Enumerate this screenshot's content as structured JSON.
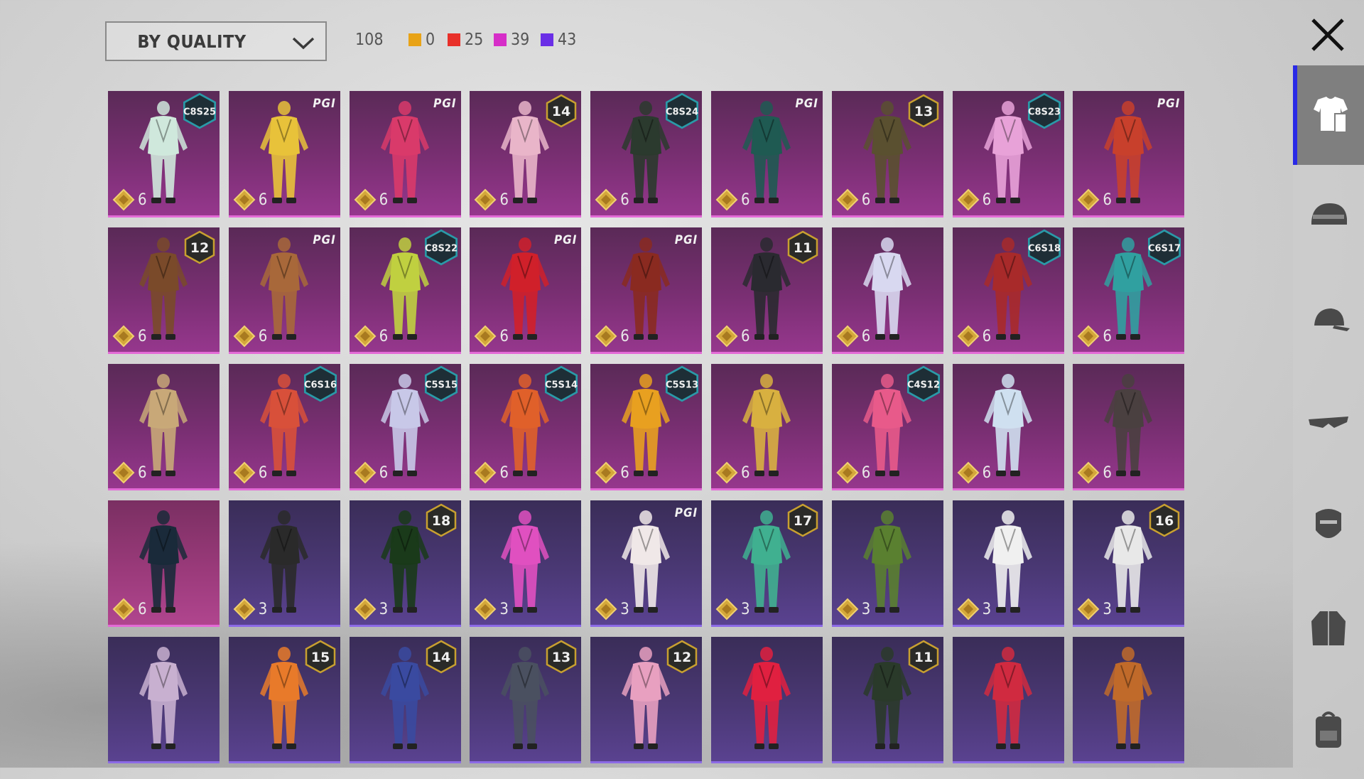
{
  "filter": {
    "label": "BY QUALITY"
  },
  "total": "108",
  "quality_counts": [
    {
      "color": "#e8a317",
      "count": "0"
    },
    {
      "color": "#e8302a",
      "count": "25"
    },
    {
      "color": "#d62ec8",
      "count": "39"
    },
    {
      "color": "#6a2ee6",
      "count": "43"
    }
  ],
  "colors": {
    "pink_tier": "#8a3380",
    "purple_tier": "#4a3874",
    "sidebar_active": "#2a2ae6"
  },
  "items": [
    {
      "rarity": "pink",
      "badge": "C8S25",
      "cost": "6",
      "tone": "#cfe8dc"
    },
    {
      "rarity": "pink",
      "badge": "PGI",
      "cost": "6",
      "tone": "#e8c23a"
    },
    {
      "rarity": "pink",
      "badge": "PGI",
      "cost": "6",
      "tone": "#d93a6a"
    },
    {
      "rarity": "pink",
      "badge": "14",
      "cost": "6",
      "tone": "#e9b5c9"
    },
    {
      "rarity": "pink",
      "badge": "C8S24",
      "cost": "6",
      "tone": "#2b3a2e"
    },
    {
      "rarity": "pink",
      "badge": "PGI",
      "cost": "6",
      "tone": "#1f5a52"
    },
    {
      "rarity": "pink",
      "badge": "13",
      "cost": "6",
      "tone": "#5a5030"
    },
    {
      "rarity": "pink",
      "badge": "C8S23",
      "cost": "6",
      "tone": "#e8a2d8"
    },
    {
      "rarity": "pink",
      "badge": "PGI",
      "cost": "6",
      "tone": "#c8402c"
    },
    {
      "rarity": "pink",
      "badge": "12",
      "cost": "6",
      "tone": "#7a4a2a"
    },
    {
      "rarity": "pink",
      "badge": "PGI",
      "cost": "6",
      "tone": "#a8683a"
    },
    {
      "rarity": "pink",
      "badge": "C8S22",
      "cost": "6",
      "tone": "#c0d040"
    },
    {
      "rarity": "pink",
      "badge": "PGI",
      "cost": "6",
      "tone": "#d0202a"
    },
    {
      "rarity": "pink",
      "badge": "PGI",
      "cost": "6",
      "tone": "#8a2a20"
    },
    {
      "rarity": "pink",
      "badge": "11",
      "cost": "6",
      "tone": "#2a2a30"
    },
    {
      "rarity": "pink",
      "badge": "",
      "cost": "6",
      "tone": "#d8d8f0"
    },
    {
      "rarity": "pink",
      "badge": "C6S18",
      "cost": "6",
      "tone": "#a82a2a"
    },
    {
      "rarity": "pink",
      "badge": "C6S17",
      "cost": "6",
      "tone": "#30a0a0"
    },
    {
      "rarity": "pink",
      "badge": "",
      "cost": "6",
      "tone": "#c8a878"
    },
    {
      "rarity": "pink",
      "badge": "C6S16",
      "cost": "6",
      "tone": "#d8503a"
    },
    {
      "rarity": "pink",
      "badge": "C5S15",
      "cost": "6",
      "tone": "#c8c8e8"
    },
    {
      "rarity": "pink",
      "badge": "C5S14",
      "cost": "6",
      "tone": "#e0602a"
    },
    {
      "rarity": "pink",
      "badge": "C5S13",
      "cost": "6",
      "tone": "#e8a020"
    },
    {
      "rarity": "pink",
      "badge": "",
      "cost": "6",
      "tone": "#d8b040"
    },
    {
      "rarity": "pink",
      "badge": "C4S12",
      "cost": "6",
      "tone": "#e85a8a"
    },
    {
      "rarity": "pink",
      "badge": "",
      "cost": "6",
      "tone": "#cfe0f0"
    },
    {
      "rarity": "pink",
      "badge": "",
      "cost": "6",
      "tone": "#4a4040"
    },
    {
      "rarity": "pink",
      "badge": "",
      "cost": "6",
      "tone": "#1a2a3a",
      "selected": true
    },
    {
      "rarity": "purple",
      "badge": "",
      "cost": "3",
      "tone": "#2a2a2a"
    },
    {
      "rarity": "purple",
      "badge": "18",
      "cost": "3",
      "tone": "#1a3a1a"
    },
    {
      "rarity": "purple",
      "badge": "",
      "cost": "3",
      "tone": "#e050c0"
    },
    {
      "rarity": "purple",
      "badge": "PGI",
      "cost": "3",
      "tone": "#f0e8e8"
    },
    {
      "rarity": "purple",
      "badge": "17",
      "cost": "3",
      "tone": "#40b090"
    },
    {
      "rarity": "purple",
      "badge": "",
      "cost": "3",
      "tone": "#5a8030"
    },
    {
      "rarity": "purple",
      "badge": "",
      "cost": "3",
      "tone": "#f0f0f0"
    },
    {
      "rarity": "purple",
      "badge": "16",
      "cost": "3",
      "tone": "#e8e8e8"
    },
    {
      "rarity": "purple",
      "badge": "",
      "cost": "",
      "tone": "#c8b0d0"
    },
    {
      "rarity": "purple",
      "badge": "15",
      "cost": "",
      "tone": "#e87a2a"
    },
    {
      "rarity": "purple",
      "badge": "14",
      "cost": "",
      "tone": "#3a4aa0"
    },
    {
      "rarity": "purple",
      "badge": "13",
      "cost": "",
      "tone": "#4a5060"
    },
    {
      "rarity": "purple",
      "badge": "12",
      "cost": "",
      "tone": "#e8a0c0"
    },
    {
      "rarity": "purple",
      "badge": "",
      "cost": "",
      "tone": "#e02040"
    },
    {
      "rarity": "purple",
      "badge": "11",
      "cost": "",
      "tone": "#2a3a2a"
    },
    {
      "rarity": "purple",
      "badge": "",
      "cost": "",
      "tone": "#d02a40"
    },
    {
      "rarity": "purple",
      "badge": "",
      "cost": "",
      "tone": "#c06a2a"
    }
  ],
  "sidebar": [
    {
      "icon": "outfit-icon",
      "active": true
    },
    {
      "icon": "helmet-icon",
      "active": false
    },
    {
      "icon": "cap-icon",
      "active": false
    },
    {
      "icon": "goggles-icon",
      "active": false
    },
    {
      "icon": "mask-icon",
      "active": false
    },
    {
      "icon": "jacket-icon",
      "active": false
    },
    {
      "icon": "backpack-icon",
      "active": false
    }
  ]
}
